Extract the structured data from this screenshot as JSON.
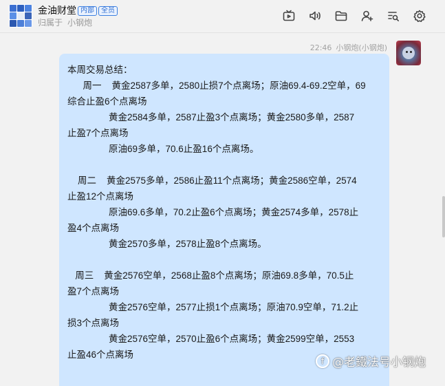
{
  "header": {
    "title": "金油财堂",
    "tags": [
      "内部",
      "全员"
    ],
    "subtitle_prefix": "归属于",
    "subtitle_owner": "小钢炮",
    "icons": [
      "tv-icon",
      "speaker-icon",
      "folder-icon",
      "add-user-icon",
      "search-list-icon",
      "settings-icon"
    ]
  },
  "message": {
    "time": "22:46",
    "sender": "小钢炮(小钢炮)",
    "lines": [
      "本周交易总结：",
      "      周一    黄金2587多单，2580止损7个点离场；原油69.4-69.2空单，69",
      "综合止盈6个点离场",
      "                黄金2584多单，2587止盈3个点离场；黄金2580多单，2587",
      "止盈7个点离场",
      "                原油69多单，70.6止盈16个点离场。",
      "",
      "    周二    黄金2575多单，2586止盈11个点离场；黄金2586空单，2574",
      "止盈12个点离场",
      "                原油69.6多单，70.2止盈6个点离场；黄金2574多单，2578止",
      "盈4个点离场",
      "                黄金2570多单，2578止盈8个点离场。",
      "",
      "   周三    黄金2576空单，2568止盈8个点离场；原油69.8多单，70.5止",
      "盈7个点离场",
      "                黄金2576空单，2577止损1个点离场；原油70.9空单，71.2止",
      "损3个点离场",
      "                黄金2576空单，2570止盈6个点离场；黄金2599空单，2553",
      "止盈46个点离场"
    ]
  },
  "watermark": {
    "text": "@老鐵法号小钢炮"
  },
  "colors": {
    "bubble": "#cfe6ff",
    "background": "#f2f2f2",
    "tag_border": "#3a7ee0"
  }
}
